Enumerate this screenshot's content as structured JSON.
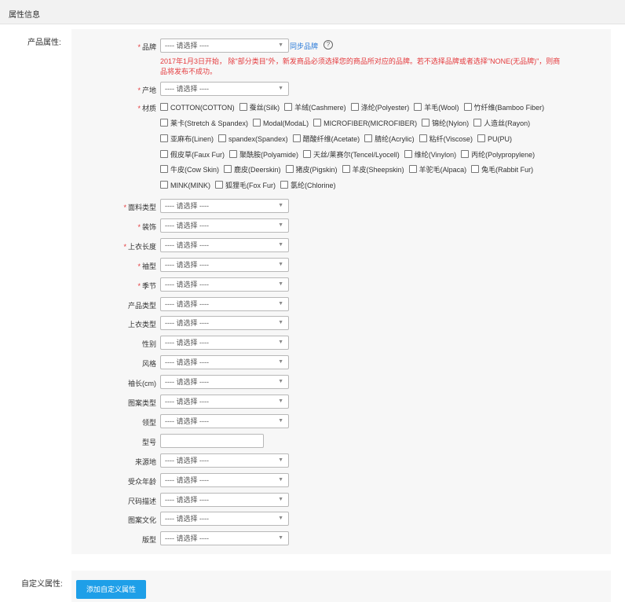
{
  "header": {
    "title": "属性信息"
  },
  "product_attrs_label": "产品属性:",
  "custom_attrs_label": "自定义属性:",
  "placeholder": "---- 请选择 ----",
  "brand": {
    "label": "品牌",
    "sync_link": "同步品牌",
    "help": "?",
    "warning_line1": "2017年1月3日开始， 除\"部分类目\"外，新发商品必须选择您的商品所对应的品牌。若不选择品牌或者选择\"NONE(无品牌)\"，则商",
    "warning_line2": "品将发布不成功。"
  },
  "origin": {
    "label": "产地"
  },
  "material": {
    "label": "材质",
    "lines": [
      [
        "COTTON(COTTON)",
        "蚕丝(Silk)",
        "羊绒(Cashmere)",
        "涤纶(Polyester)",
        "羊毛(Wool)",
        "竹纤维(Bamboo Fiber)"
      ],
      [
        "莱卡(Stretch & Spandex)",
        "Modal(ModaL)",
        "MICROFIBER(MICROFIBER)",
        "锦纶(Nylon)",
        "人造丝(Rayon)"
      ],
      [
        "亚麻布(Linen)",
        "spandex(Spandex)",
        "醋酸纤维(Acetate)",
        "腈纶(Acrylic)",
        "粘纤(Viscose)",
        "PU(PU)"
      ],
      [
        "假皮草(Faux Fur)",
        "聚酰胺(Polyamide)",
        "天丝/莱赛尔(Tencel/Lyocell)",
        "维纶(Vinylon)",
        "丙纶(Polypropylene)"
      ],
      [
        "牛皮(Cow Skin)",
        "鹿皮(Deerskin)",
        "猪皮(Pigskin)",
        "羊皮(Sheepskin)",
        "羊驼毛(Alpaca)",
        "兔毛(Rabbit Fur)"
      ],
      [
        "MINK(MINK)",
        "狐狸毛(Fox Fur)",
        "氯纶(Chlorine)"
      ]
    ]
  },
  "fields": [
    {
      "label": "面料类型",
      "required": true
    },
    {
      "label": "装饰",
      "required": true
    },
    {
      "label": "上衣长度",
      "required": true
    },
    {
      "label": "袖型",
      "required": true
    },
    {
      "label": "季节",
      "required": true
    },
    {
      "label": "产品类型",
      "required": false
    },
    {
      "label": "上衣类型",
      "required": false
    },
    {
      "label": "性别",
      "required": false
    },
    {
      "label": "风格",
      "required": false
    },
    {
      "label": "袖长(cm)",
      "required": false
    },
    {
      "label": "图案类型",
      "required": false
    },
    {
      "label": "领型",
      "required": false
    },
    {
      "label": "型号",
      "required": false,
      "input": true
    },
    {
      "label": "来源地",
      "required": false
    },
    {
      "label": "受众年龄",
      "required": false
    },
    {
      "label": "尺码描述",
      "required": false
    },
    {
      "label": "图案文化",
      "required": false
    },
    {
      "label": "版型",
      "required": false
    }
  ],
  "required_mark": "*",
  "add_custom_button": "添加自定义属性",
  "colors": {
    "required": "#e4393c",
    "link": "#2a7ad8",
    "button": "#1e9fe8"
  }
}
